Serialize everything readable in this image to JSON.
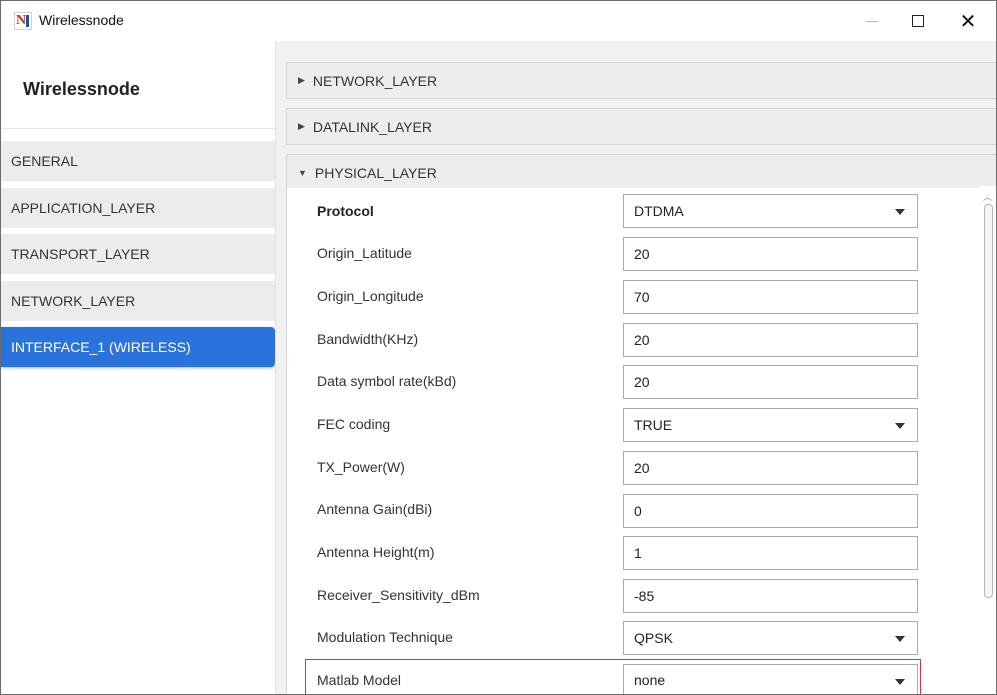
{
  "window": {
    "title": "Wirelessnode",
    "icon": "netsim-app-icon",
    "controls": {
      "minimize": "minimize-icon",
      "maximize": "maximize-icon",
      "close": "close-icon",
      "close_glyph": "✕"
    }
  },
  "sidebar": {
    "title": "Wirelessnode",
    "items": [
      {
        "label": "GENERAL",
        "active": false
      },
      {
        "label": "APPLICATION_LAYER",
        "active": false
      },
      {
        "label": "TRANSPORT_LAYER",
        "active": false
      },
      {
        "label": "NETWORK_LAYER",
        "active": false
      },
      {
        "label": "INTERFACE_1 (WIRELESS)",
        "active": true
      }
    ]
  },
  "sections": [
    {
      "label": "NETWORK_LAYER",
      "expanded": false
    },
    {
      "label": "DATALINK_LAYER",
      "expanded": false
    },
    {
      "label": "PHYSICAL_LAYER",
      "expanded": true
    }
  ],
  "physical_layer": {
    "properties": [
      {
        "label": "Protocol",
        "value": "DTDMA",
        "type": "dropdown"
      },
      {
        "label": "Origin_Latitude",
        "value": "20",
        "type": "text"
      },
      {
        "label": "Origin_Longitude",
        "value": "70",
        "type": "text"
      },
      {
        "label": "Bandwidth(KHz)",
        "value": "20",
        "type": "text"
      },
      {
        "label": "Data symbol rate(kBd)",
        "value": "20",
        "type": "text"
      },
      {
        "label": "FEC coding",
        "value": "TRUE",
        "type": "dropdown"
      },
      {
        "label": "TX_Power(W)",
        "value": "20",
        "type": "text"
      },
      {
        "label": "Antenna Gain(dBi)",
        "value": "0",
        "type": "text"
      },
      {
        "label": "Antenna Height(m)",
        "value": "1",
        "type": "text"
      },
      {
        "label": "Receiver_Sensitivity_dBm",
        "value": "-85",
        "type": "text"
      },
      {
        "label": "Modulation Technique",
        "value": "QPSK",
        "type": "dropdown"
      },
      {
        "label": "Matlab Model",
        "value": "none",
        "type": "dropdown",
        "highlighted": true
      }
    ]
  },
  "colors": {
    "accent": "#2a72dc",
    "highlight_border": "#d9324b"
  }
}
